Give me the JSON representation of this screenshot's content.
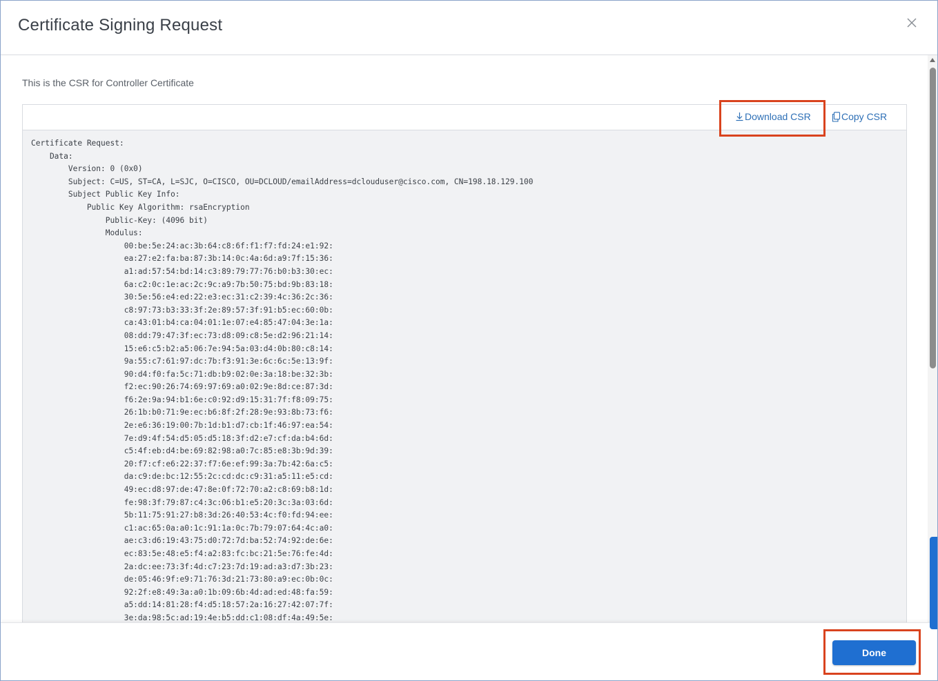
{
  "dialog": {
    "title": "Certificate Signing Request",
    "close_icon": "close-icon"
  },
  "body": {
    "description": "This is the CSR for Controller Certificate",
    "toolbar": {
      "download_label": "Download CSR",
      "download_icon": "download-icon",
      "copy_label": "Copy CSR",
      "copy_icon": "copy-icon"
    },
    "csr_text": "Certificate Request:\n    Data:\n        Version: 0 (0x0)\n        Subject: C=US, ST=CA, L=SJC, O=CISCO, OU=DCLOUD/emailAddress=dclouduser@cisco.com, CN=198.18.129.100\n        Subject Public Key Info:\n            Public Key Algorithm: rsaEncryption\n                Public-Key: (4096 bit)\n                Modulus:\n                    00:be:5e:24:ac:3b:64:c8:6f:f1:f7:fd:24:e1:92:\n                    ea:27:e2:fa:ba:87:3b:14:0c:4a:6d:a9:7f:15:36:\n                    a1:ad:57:54:bd:14:c3:89:79:77:76:b0:b3:30:ec:\n                    6a:c2:0c:1e:ac:2c:9c:a9:7b:50:75:bd:9b:83:18:\n                    30:5e:56:e4:ed:22:e3:ec:31:c2:39:4c:36:2c:36:\n                    c8:97:73:b3:33:3f:2e:89:57:3f:91:b5:ec:60:0b:\n                    ca:43:01:b4:ca:04:01:1e:07:e4:85:47:04:3e:1a:\n                    08:dd:79:47:3f:ec:73:d8:09:c8:5e:d2:96:21:14:\n                    15:e6:c5:b2:a5:06:7e:94:5a:03:d4:0b:80:c8:14:\n                    9a:55:c7:61:97:dc:7b:f3:91:3e:6c:6c:5e:13:9f:\n                    90:d4:f0:fa:5c:71:db:b9:02:0e:3a:18:be:32:3b:\n                    f2:ec:90:26:74:69:97:69:a0:02:9e:8d:ce:87:3d:\n                    f6:2e:9a:94:b1:6e:c0:92:d9:15:31:7f:f8:09:75:\n                    26:1b:b0:71:9e:ec:b6:8f:2f:28:9e:93:8b:73:f6:\n                    2e:e6:36:19:00:7b:1d:b1:d7:cb:1f:46:97:ea:54:\n                    7e:d9:4f:54:d5:05:d5:18:3f:d2:e7:cf:da:b4:6d:\n                    c5:4f:eb:d4:be:69:82:98:a0:7c:85:e8:3b:9d:39:\n                    20:f7:cf:e6:22:37:f7:6e:ef:99:3a:7b:42:6a:c5:\n                    da:c9:de:bc:12:55:2c:cd:dc:c9:31:a5:11:e5:cd:\n                    49:ec:d8:97:de:47:8e:0f:72:70:a2:c8:69:b8:1d:\n                    fe:98:3f:79:87:c4:3c:06:b1:e5:20:3c:3a:03:6d:\n                    5b:11:75:91:27:b8:3d:26:40:53:4c:f0:fd:94:ee:\n                    c1:ac:65:0a:a0:1c:91:1a:0c:7b:79:07:64:4c:a0:\n                    ae:c3:d6:19:43:75:d0:72:7d:ba:52:74:92:de:6e:\n                    ec:83:5e:48:e5:f4:a2:83:fc:bc:21:5e:76:fe:4d:\n                    2a:dc:ee:73:3f:4d:c7:23:7d:19:ad:a3:d7:3b:23:\n                    de:05:46:9f:e9:71:76:3d:21:73:80:a9:ec:0b:0c:\n                    92:2f:e8:49:3a:a0:1b:09:6b:4d:ad:ed:48:fa:59:\n                    a5:dd:14:81:28:f4:d5:18:57:2a:16:27:42:07:7f:\n                    3e:da:98:5c:ad:19:4e:b5:dd:c1:08:df:4a:49:5e:"
  },
  "footer": {
    "done_label": "Done"
  },
  "colors": {
    "accent": "#1f6fd1",
    "link": "#2d6fb6",
    "highlight": "#d9431e"
  }
}
